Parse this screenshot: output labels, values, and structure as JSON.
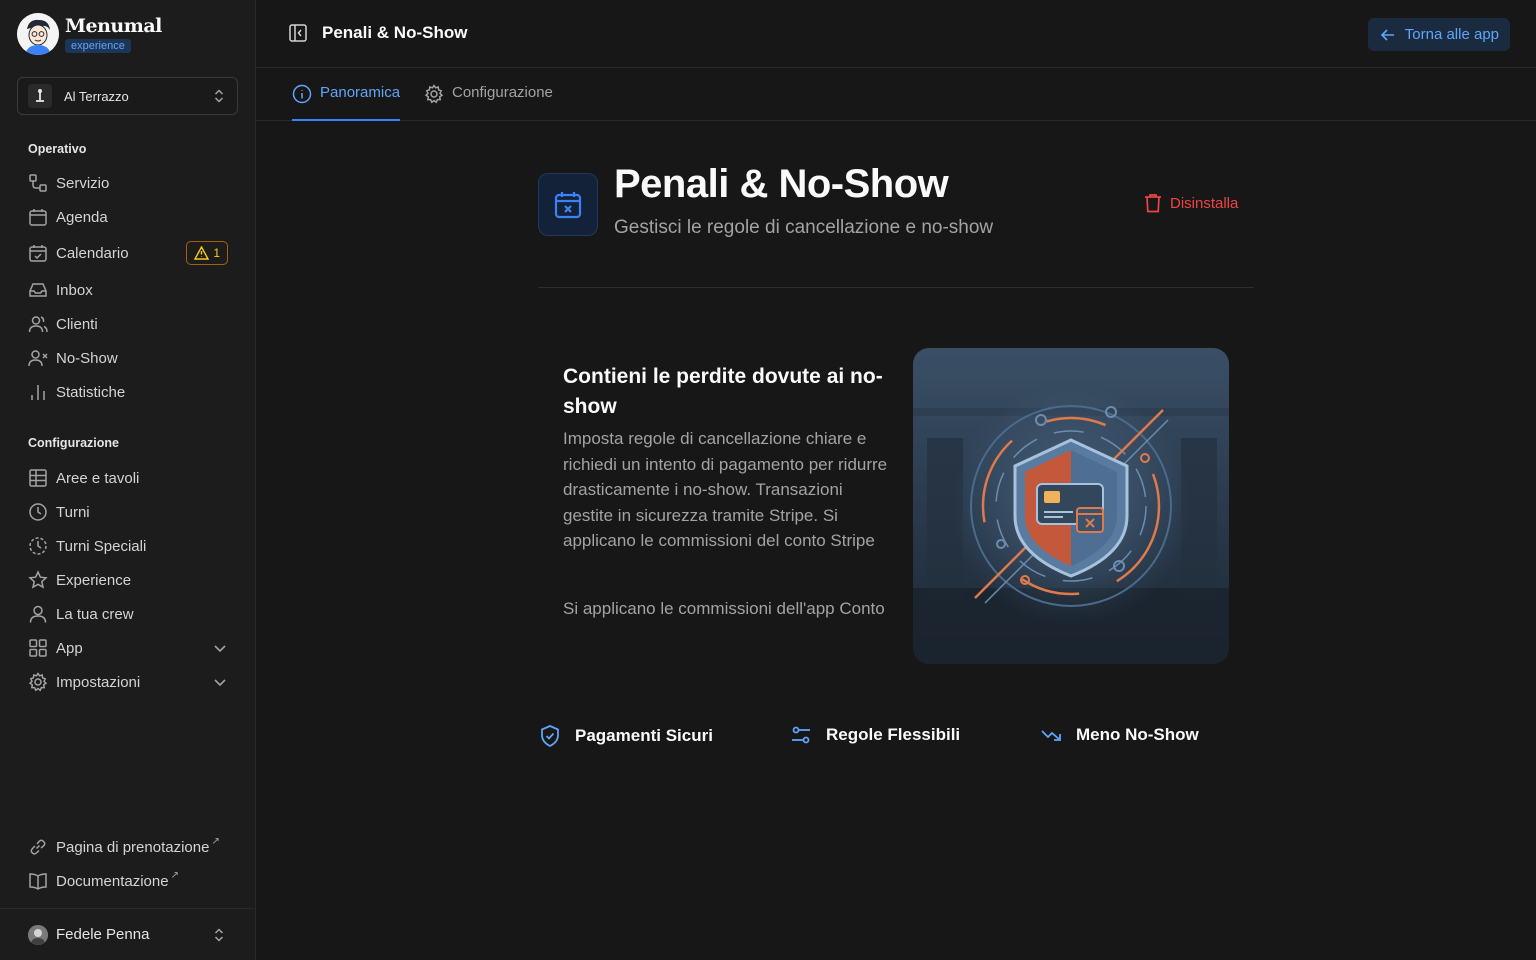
{
  "brand": {
    "name": "Menumal",
    "badge": "experience"
  },
  "venue": {
    "name": "Al Terrazzo"
  },
  "sidebar": {
    "sections": {
      "operativo": "Operativo",
      "configurazione": "Configurazione"
    },
    "operativo_items": [
      {
        "label": "Servizio",
        "icon": "workflow-icon"
      },
      {
        "label": "Agenda",
        "icon": "calendar-icon"
      },
      {
        "label": "Calendario",
        "icon": "calendar-check-icon",
        "badge": "1"
      },
      {
        "label": "Inbox",
        "icon": "inbox-icon"
      },
      {
        "label": "Clienti",
        "icon": "users-icon"
      },
      {
        "label": "No-Show",
        "icon": "user-x-icon"
      },
      {
        "label": "Statistiche",
        "icon": "bar-chart-icon"
      }
    ],
    "config_items": [
      {
        "label": "Aree e tavoli",
        "icon": "table-icon"
      },
      {
        "label": "Turni",
        "icon": "clock-icon"
      },
      {
        "label": "Turni Speciali",
        "icon": "clock-dashed-icon"
      },
      {
        "label": "Experience",
        "icon": "star-icon"
      },
      {
        "label": "La tua crew",
        "icon": "user-icon"
      },
      {
        "label": "App",
        "icon": "grid-icon"
      },
      {
        "label": "Impostazioni",
        "icon": "gear-icon"
      }
    ],
    "footer_links": [
      {
        "label": "Pagina di prenotazione",
        "icon": "link-icon"
      },
      {
        "label": "Documentazione",
        "icon": "book-icon"
      }
    ],
    "user": {
      "name": "Fedele Penna"
    }
  },
  "header": {
    "title": "Penali & No-Show",
    "back_label": "Torna alle app"
  },
  "tabs": [
    {
      "label": "Panoramica",
      "active": true
    },
    {
      "label": "Configurazione",
      "active": false
    }
  ],
  "app": {
    "title": "Penali & No-Show",
    "subtitle": "Gestisci le regole di cancellazione e no-show",
    "uninstall_label": "Disinstalla"
  },
  "feature": {
    "heading": "Contieni le perdite dovute ai no-show",
    "description": "Imposta regole di cancellazione chiare e richiedi un intento di pagamento per ridurre drasticamente i no-show. Transazioni gestite in sicurezza tramite Stripe. Si applicano le commissioni del conto Stripe",
    "note": "Si applicano le commissioni dell'app Conto"
  },
  "perks": [
    {
      "label": "Pagamenti Sicuri",
      "icon": "shield-check-icon"
    },
    {
      "label": "Regole Flessibili",
      "icon": "sliders-icon"
    },
    {
      "label": "Meno No-Show",
      "icon": "trending-down-icon"
    }
  ],
  "colors": {
    "accent": "#3b82f6",
    "danger": "#ef4444",
    "warning": "#facc15",
    "background": "#171717",
    "sidebar": "#1c1c1c"
  }
}
